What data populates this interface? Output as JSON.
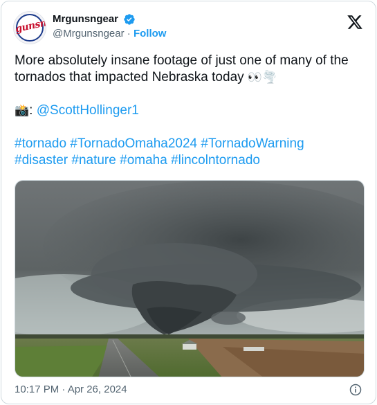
{
  "author": {
    "display_name": "Mrgunsngear",
    "handle": "@Mrgunsngear",
    "separator": " · ",
    "follow_label": "Follow",
    "avatar_text": "gunsng",
    "verified": true
  },
  "tweet": {
    "text_line": "More absolutely insane footage of just one of many of the tornados that impacted Nebraska today",
    "text_emojis": "👀🌪️",
    "credit_emoji": "📸",
    "credit_sep": ": ",
    "credit_mention": "@ScottHollinger1",
    "hashtags": [
      "#tornado",
      "#TornadoOmaha2024",
      "#TornadoWarning",
      "#disaster",
      "#nature",
      "#omaha",
      "#lincolntornado"
    ]
  },
  "footer": {
    "timestamp": "10:17 PM · Apr 26, 2024"
  },
  "icons": {
    "brand": "x-logo-icon",
    "verified": "verified-badge-icon",
    "info": "info-icon",
    "camera": "camera-flash-emoji"
  },
  "colors": {
    "link": "#1d9bf0",
    "text": "#0f1419",
    "muted": "#536471",
    "border": "#cfd9de"
  }
}
